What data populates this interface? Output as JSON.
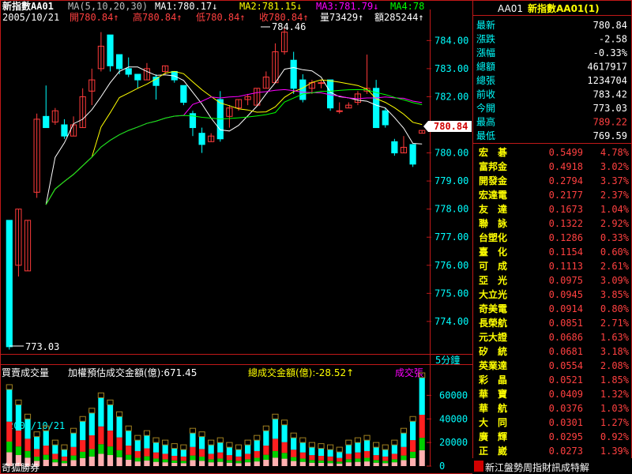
{
  "header": {
    "title": "新指數AA01",
    "ma_label": "MA(5,10,20,30)",
    "ma1": "MA1:780.17↓",
    "ma2": "MA2:781.15↓",
    "ma3": "MA3:781.79↓",
    "ma4": "MA4:78",
    "date": "2005/10/21",
    "open": "開780.84↑",
    "high": "高780.84↑",
    "low": "低780.84↑",
    "close": "收780.84↑",
    "vol": "量73429↑",
    "amt": "額285244↑"
  },
  "price_axis": {
    "ticks": [
      "784.00",
      "783.00",
      "782.00",
      "781.00",
      "780.00",
      "779.00",
      "778.00",
      "777.00",
      "776.00",
      "775.00",
      "774.00"
    ],
    "current_tag": "780.84",
    "high_label": "784.46",
    "low_label": "773.03",
    "interval": "5分鐘"
  },
  "volume_panel": {
    "title1": "買賣成交量",
    "title2": "加權預估成交金額(億):671.45",
    "title3": "總成交金額(億):-28.52↑",
    "title4": "成交張",
    "date": "2005/10/21",
    "ticks": [
      "60000",
      "40000",
      "20000",
      "0"
    ],
    "source": "奇狐勝券"
  },
  "quote": {
    "code": "AA01",
    "name": "新指數AA01(1)",
    "rows": [
      {
        "label": "最新",
        "value": "780.84",
        "color": "#ffffff"
      },
      {
        "label": "漲跌",
        "value": "-2.58",
        "color": "#ffffff"
      },
      {
        "label": "漲幅",
        "value": "-0.33%",
        "color": "#ffffff"
      },
      {
        "label": "總額",
        "value": "4617917",
        "color": "#ffffff"
      },
      {
        "label": "總張",
        "value": "1234704",
        "color": "#ffffff"
      },
      {
        "label": "前收",
        "value": "783.42",
        "color": "#ffffff"
      },
      {
        "label": "今開",
        "value": "773.03",
        "color": "#ffffff"
      },
      {
        "label": "最高",
        "value": "789.22",
        "color": "#ff4040"
      },
      {
        "label": "最低",
        "value": "769.59",
        "color": "#ffffff"
      }
    ]
  },
  "stocks": [
    {
      "name": "宏　碁",
      "value": "0.5499",
      "pct": "4.78%"
    },
    {
      "name": "富邦金",
      "value": "0.4918",
      "pct": "3.02%"
    },
    {
      "name": "開發金",
      "value": "0.2794",
      "pct": "3.37%"
    },
    {
      "name": "宏達電",
      "value": "0.2177",
      "pct": "2.37%"
    },
    {
      "name": "友　達",
      "value": "0.1673",
      "pct": "1.04%"
    },
    {
      "name": "聯　詠",
      "value": "0.1322",
      "pct": "2.92%"
    },
    {
      "name": "台塑化",
      "value": "0.1286",
      "pct": "0.33%"
    },
    {
      "name": "臺　化",
      "value": "0.1154",
      "pct": "0.60%"
    },
    {
      "name": "可　成",
      "value": "0.1113",
      "pct": "2.61%"
    },
    {
      "name": "亞　光",
      "value": "0.0975",
      "pct": "3.09%"
    },
    {
      "name": "大立光",
      "value": "0.0945",
      "pct": "3.85%"
    },
    {
      "name": "奇美電",
      "value": "0.0914",
      "pct": "0.80%"
    },
    {
      "name": "長榮航",
      "value": "0.0851",
      "pct": "2.71%"
    },
    {
      "name": "元大證",
      "value": "0.0686",
      "pct": "1.63%"
    },
    {
      "name": "矽　統",
      "value": "0.0681",
      "pct": "3.18%"
    },
    {
      "name": "英業達",
      "value": "0.0554",
      "pct": "2.08%"
    },
    {
      "name": "彩　晶",
      "value": "0.0521",
      "pct": "1.85%"
    },
    {
      "name": "華　寶",
      "value": "0.0409",
      "pct": "1.32%"
    },
    {
      "name": "華　航",
      "value": "0.0376",
      "pct": "1.03%"
    },
    {
      "name": "大　同",
      "value": "0.0301",
      "pct": "1.27%"
    },
    {
      "name": "廣　輝",
      "value": "0.0295",
      "pct": "0.92%"
    },
    {
      "name": "正　崴",
      "value": "0.0273",
      "pct": "1.39%"
    }
  ],
  "footer": {
    "ticker": "新江盤勢周指財訊成特解"
  },
  "colors": {
    "up": "#ff3b3b",
    "down": "#00ffff",
    "axis": "#c01818",
    "ma1": "#ffffff",
    "ma2": "#ffff00",
    "ma3": "#ff00ff",
    "ma4": "#00ff00",
    "label": "#00ffff",
    "stock_name": "#ffff00",
    "stock_value": "#ff4040"
  },
  "chart_data": {
    "type": "candlestick",
    "ylim": [
      772.9,
      784.6
    ],
    "candles": [
      {
        "o": 777.6,
        "h": 777.6,
        "l": 773.0,
        "c": 773.1
      },
      {
        "o": 776.0,
        "h": 778.0,
        "l": 775.6,
        "c": 778.0
      },
      {
        "o": 775.8,
        "h": 777.6,
        "l": 775.8,
        "c": 777.6
      },
      {
        "o": 778.6,
        "h": 781.4,
        "l": 778.4,
        "c": 781.2
      },
      {
        "o": 781.3,
        "h": 782.4,
        "l": 780.9,
        "c": 780.9
      },
      {
        "o": 781.1,
        "h": 781.6,
        "l": 781.0,
        "c": 781.5
      },
      {
        "o": 781.0,
        "h": 781.2,
        "l": 780.5,
        "c": 780.6
      },
      {
        "o": 780.6,
        "h": 781.3,
        "l": 780.6,
        "c": 781.0
      },
      {
        "o": 780.9,
        "h": 782.3,
        "l": 780.9,
        "c": 782.0
      },
      {
        "o": 782.2,
        "h": 783.0,
        "l": 781.7,
        "c": 782.6
      },
      {
        "o": 783.0,
        "h": 784.3,
        "l": 782.9,
        "c": 783.8
      },
      {
        "o": 784.2,
        "h": 784.2,
        "l": 782.9,
        "c": 783.1
      },
      {
        "o": 783.5,
        "h": 783.5,
        "l": 782.8,
        "c": 783.0
      },
      {
        "o": 783.0,
        "h": 783.4,
        "l": 782.7,
        "c": 782.8
      },
      {
        "o": 782.8,
        "h": 782.8,
        "l": 782.3,
        "c": 782.6
      },
      {
        "o": 782.6,
        "h": 783.2,
        "l": 782.6,
        "c": 783.0
      },
      {
        "o": 782.7,
        "h": 782.8,
        "l": 781.9,
        "c": 782.4
      },
      {
        "o": 782.9,
        "h": 783.1,
        "l": 782.8,
        "c": 783.1
      },
      {
        "o": 782.9,
        "h": 782.9,
        "l": 782.5,
        "c": 782.6
      },
      {
        "o": 782.4,
        "h": 782.4,
        "l": 781.7,
        "c": 781.8
      },
      {
        "o": 781.4,
        "h": 781.5,
        "l": 780.6,
        "c": 780.9
      },
      {
        "o": 780.7,
        "h": 780.9,
        "l": 780.0,
        "c": 780.3
      },
      {
        "o": 780.4,
        "h": 780.7,
        "l": 780.4,
        "c": 780.6
      },
      {
        "o": 781.9,
        "h": 782.2,
        "l": 780.4,
        "c": 780.5
      },
      {
        "o": 781.3,
        "h": 781.7,
        "l": 780.9,
        "c": 781.6
      },
      {
        "o": 781.6,
        "h": 781.9,
        "l": 781.5,
        "c": 781.9
      },
      {
        "o": 781.9,
        "h": 782.1,
        "l": 781.7,
        "c": 782.0
      },
      {
        "o": 781.7,
        "h": 782.3,
        "l": 781.7,
        "c": 782.3
      },
      {
        "o": 782.3,
        "h": 782.9,
        "l": 782.3,
        "c": 782.7
      },
      {
        "o": 782.5,
        "h": 783.9,
        "l": 782.5,
        "c": 783.6
      },
      {
        "o": 783.6,
        "h": 784.5,
        "l": 783.5,
        "c": 784.3
      },
      {
        "o": 783.3,
        "h": 783.6,
        "l": 782.1,
        "c": 782.3
      },
      {
        "o": 782.6,
        "h": 782.8,
        "l": 781.8,
        "c": 781.9
      },
      {
        "o": 782.3,
        "h": 782.6,
        "l": 782.1,
        "c": 782.5
      },
      {
        "o": 782.5,
        "h": 782.6,
        "l": 782.3,
        "c": 782.5
      },
      {
        "o": 782.6,
        "h": 782.6,
        "l": 781.5,
        "c": 781.6
      },
      {
        "o": 781.5,
        "h": 781.8,
        "l": 781.4,
        "c": 781.5
      },
      {
        "o": 781.6,
        "h": 781.8,
        "l": 781.6,
        "c": 781.7
      },
      {
        "o": 781.8,
        "h": 782.2,
        "l": 781.7,
        "c": 782.1
      },
      {
        "o": 782.2,
        "h": 783.5,
        "l": 782.1,
        "c": 782.3
      },
      {
        "o": 782.3,
        "h": 782.6,
        "l": 781.9,
        "c": 780.9
      },
      {
        "o": 781.5,
        "h": 781.6,
        "l": 780.9,
        "c": 781.0
      },
      {
        "o": 780.4,
        "h": 780.5,
        "l": 779.9,
        "c": 780.0
      },
      {
        "o": 780.0,
        "h": 780.6,
        "l": 780.0,
        "c": 780.2
      },
      {
        "o": 780.3,
        "h": 780.3,
        "l": 779.5,
        "c": 779.6
      },
      {
        "o": 780.7,
        "h": 780.8,
        "l": 780.7,
        "c": 780.8
      }
    ],
    "volume_ylim": [
      0,
      75000
    ],
    "volume": [
      65000,
      52000,
      40000,
      25000,
      30000,
      18000,
      14000,
      28000,
      38000,
      45000,
      58000,
      52000,
      42000,
      30000,
      22000,
      26000,
      20000,
      18000,
      15000,
      14000,
      28000,
      25000,
      18000,
      20000,
      16000,
      14000,
      18000,
      22000,
      30000,
      40000,
      35000,
      24000,
      20000,
      16000,
      15000,
      14000,
      12000,
      18000,
      20000,
      22000,
      16000,
      14000,
      18000,
      28000,
      38000,
      75000
    ]
  }
}
